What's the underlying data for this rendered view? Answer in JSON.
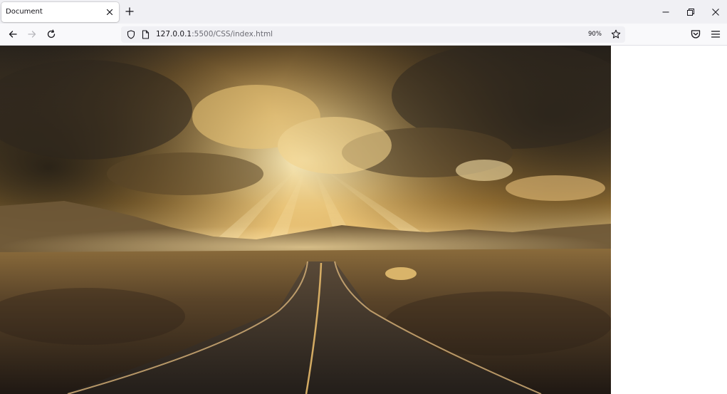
{
  "tab": {
    "title": "Document",
    "close_icon": "close-icon",
    "new_tab_icon": "plus-icon"
  },
  "window_controls": {
    "minimize_icon": "minimize-icon",
    "restore_icon": "restore-icon",
    "close_icon": "close-icon"
  },
  "navbar": {
    "back_icon": "arrow-left-icon",
    "forward_icon": "arrow-right-icon",
    "reload_icon": "reload-icon",
    "url_host": "127.0.0.1",
    "url_rest": ":5500/CSS/index.html",
    "zoom": "90%",
    "bookmark_icon": "star-icon",
    "pocket_icon": "pocket-icon",
    "menu_icon": "hamburger-menu-icon"
  },
  "content": {
    "image_subject": "sun rays through clouds over a desert road",
    "palette": {
      "sky_glow": "#f6d58c",
      "gold": "#d9a441",
      "dark_cloud": "#3d3225",
      "road": "#2b2622",
      "road_line": "#e6b96a"
    }
  }
}
